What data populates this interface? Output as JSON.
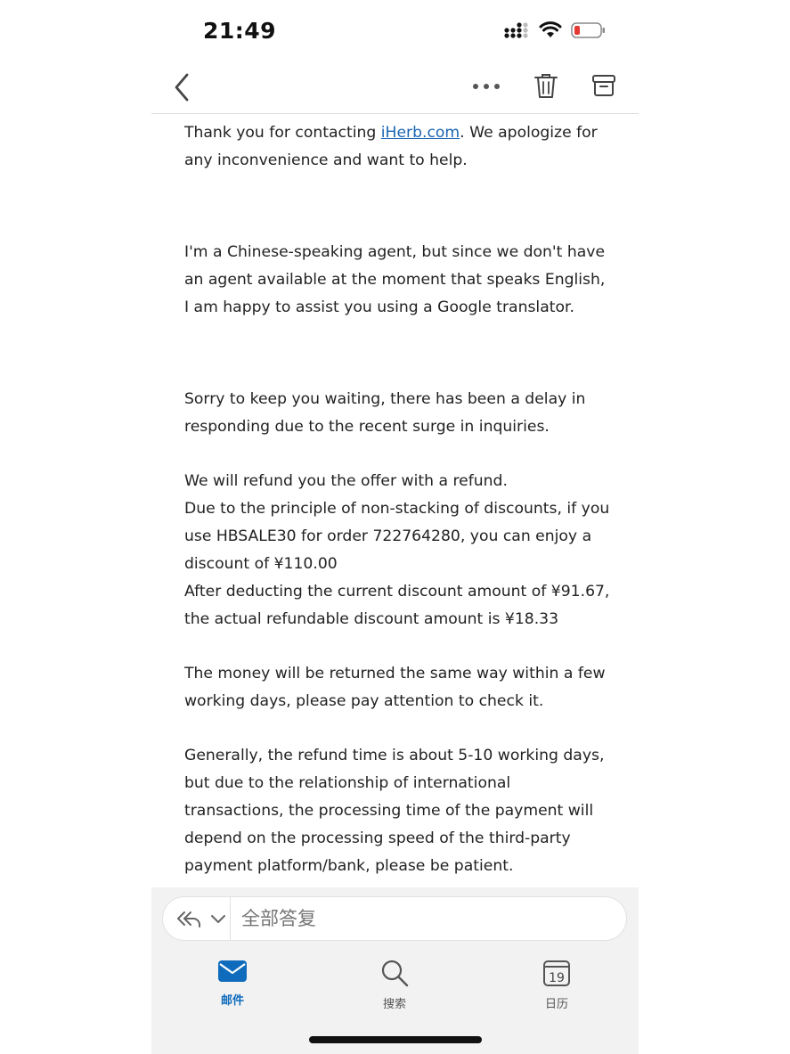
{
  "status_bar": {
    "time": "21:49"
  },
  "icons": {
    "back": "chevron-left-icon",
    "more": "ellipsis-icon",
    "delete": "trash-icon",
    "archive": "archive-icon",
    "reply": "reply-all-icon",
    "expand": "chevron-down-icon",
    "mail": "mail-icon",
    "search": "search-icon",
    "calendar": "calendar-icon"
  },
  "colors": {
    "accent": "#0f6cbd",
    "link": "#1a66b3",
    "battery_low": "#e53935"
  },
  "email": {
    "p1_before_link": "Thank you for contacting ",
    "p1_link": "iHerb.com",
    "p1_after_link": ". We apologize for any inconvenience and want to help.",
    "p2": "I'm a Chinese-speaking agent, but since we don't have an agent available at the moment that speaks English, I am happy to assist you using a Google translator.",
    "p3": "Sorry to keep you waiting, there has been a delay in responding due to the recent surge in inquiries.",
    "p4_lines": [
      "We will refund you the offer with a refund.",
      "Due to the principle of non-stacking of discounts, if you use HBSALE30 for order 722764280, you can enjoy a discount of ¥110.00",
      "After deducting the current discount amount of ¥91.67, the actual refundable discount amount is ¥18.33"
    ],
    "p5": "The money will be returned the same way within a few working days, please pay attention to check it.",
    "p6": "Generally, the refund time is about 5-10 working days, but due to the relationship of international transactions, the processing time of the payment will depend on the processing speed of the third-party payment platform/bank, please be patient."
  },
  "reply_bar": {
    "placeholder": "全部答复"
  },
  "tabs": {
    "mail": "邮件",
    "search": "搜索",
    "calendar": "日历",
    "calendar_day": "19"
  }
}
